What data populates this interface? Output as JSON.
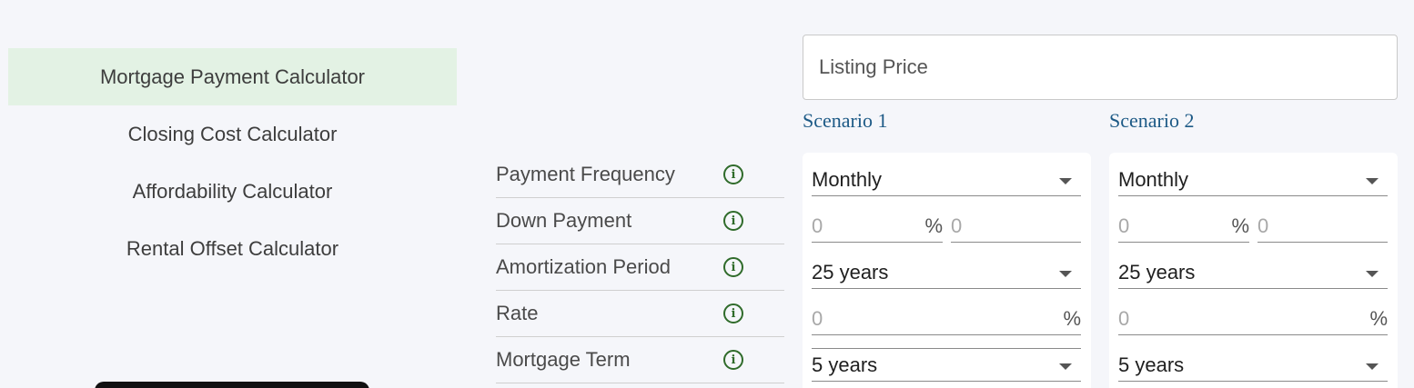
{
  "nav": {
    "items": [
      {
        "label": "Mortgage Payment Calculator"
      },
      {
        "label": "Closing Cost Calculator"
      },
      {
        "label": "Affordability Calculator"
      },
      {
        "label": "Rental Offset Calculator"
      }
    ]
  },
  "listing_price": {
    "placeholder": "Listing Price"
  },
  "scenarios": {
    "s1_title": "Scenario 1",
    "s2_title": "Scenario 2"
  },
  "rows": [
    {
      "label": "Payment Frequency",
      "icon": "info-icon"
    },
    {
      "label": "Down Payment",
      "icon": "info-icon"
    },
    {
      "label": "Amortization Period",
      "icon": "info-icon"
    },
    {
      "label": "Rate",
      "icon": "info-icon"
    },
    {
      "label": "Mortgage Term",
      "icon": "info-icon"
    }
  ],
  "info_glyph": "i",
  "scenario1": {
    "payment_frequency": "Monthly",
    "down_payment_percent_placeholder": "0",
    "down_payment_percent_unit": "%",
    "down_payment_amount_placeholder": "0",
    "amortization_period": "25 years",
    "rate_placeholder": "0",
    "rate_unit": "%",
    "mortgage_term": "5 years"
  },
  "scenario2": {
    "payment_frequency": "Monthly",
    "down_payment_percent_placeholder": "0",
    "down_payment_percent_unit": "%",
    "down_payment_amount_placeholder": "0",
    "amortization_period": "25 years",
    "rate_placeholder": "0",
    "rate_unit": "%",
    "mortgage_term": "5 years"
  },
  "colors": {
    "active_nav_bg": "#e3f2e4",
    "scenario_title": "#1d5a86",
    "info_icon": "#2f6b2a",
    "page_bg": "#f5f6fa"
  }
}
